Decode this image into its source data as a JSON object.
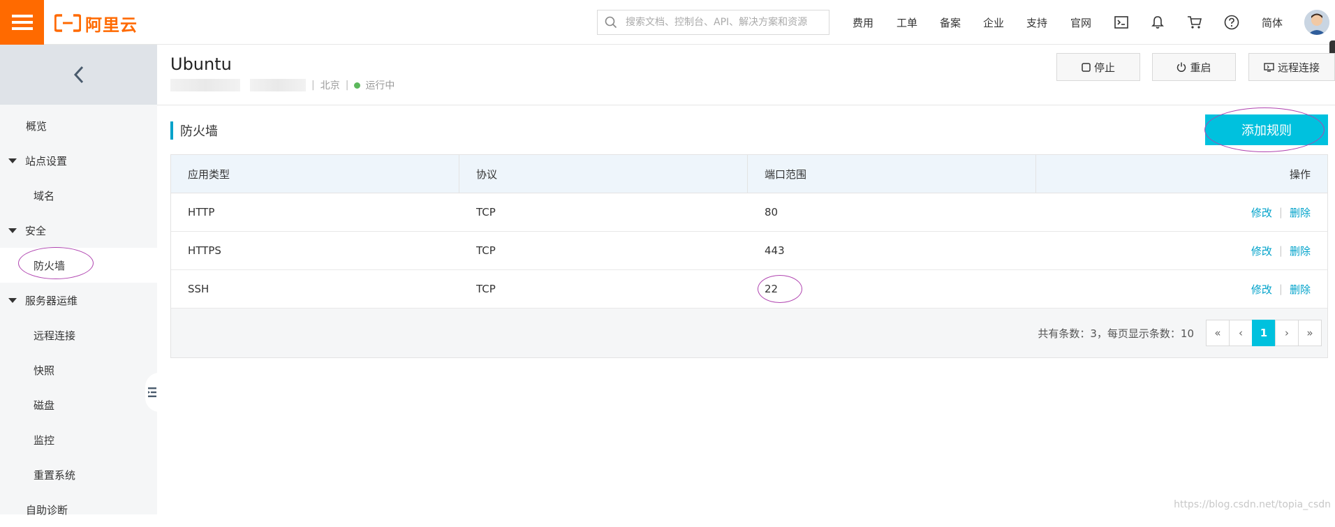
{
  "topbar": {
    "menu_icon": "hamburger-icon",
    "logo_text": "阿里云",
    "search_placeholder": "搜索文档、控制台、API、解决方案和资源",
    "nav": [
      "费用",
      "工单",
      "备案",
      "企业",
      "支持",
      "官网"
    ],
    "icons": [
      "terminal-icon",
      "bell-icon",
      "cart-icon",
      "help-icon"
    ],
    "language": "简体"
  },
  "sidebar": {
    "back_icon": "chevron-left-icon",
    "items": {
      "overview": "概览",
      "site_settings": "站点设置",
      "domain": "域名",
      "security": "安全",
      "firewall": "防火墙",
      "server_ops": "服务器运维",
      "remote_connect": "远程连接",
      "snapshot": "快照",
      "disk": "磁盘",
      "monitor": "监控",
      "reset_system": "重置系统",
      "self_diagnosis": "自助诊断"
    },
    "active": "防火墙"
  },
  "instance": {
    "title": "Ubuntu",
    "region": "北京",
    "status": "运行中",
    "status_color": "#5cb85c",
    "actions": {
      "stop": "停止",
      "restart": "重启",
      "remote": "远程连接"
    }
  },
  "firewall": {
    "section_title": "防火墙",
    "add_button": "添加规则",
    "accent": "#00c1de",
    "columns": [
      "应用类型",
      "协议",
      "端口范围",
      "操作"
    ],
    "rows": [
      {
        "app": "HTTP",
        "protocol": "TCP",
        "port": "80"
      },
      {
        "app": "HTTPS",
        "protocol": "TCP",
        "port": "443"
      },
      {
        "app": "SSH",
        "protocol": "TCP",
        "port": "22"
      }
    ],
    "edit_label": "修改",
    "delete_label": "删除",
    "pipe": "|",
    "total_text": "共有条数：3，每页显示条数：10",
    "pager": {
      "first": "«",
      "prev": "‹",
      "current": "1",
      "next": "›",
      "last": "»"
    }
  },
  "watermark": "https://blog.csdn.net/topia_csdn"
}
